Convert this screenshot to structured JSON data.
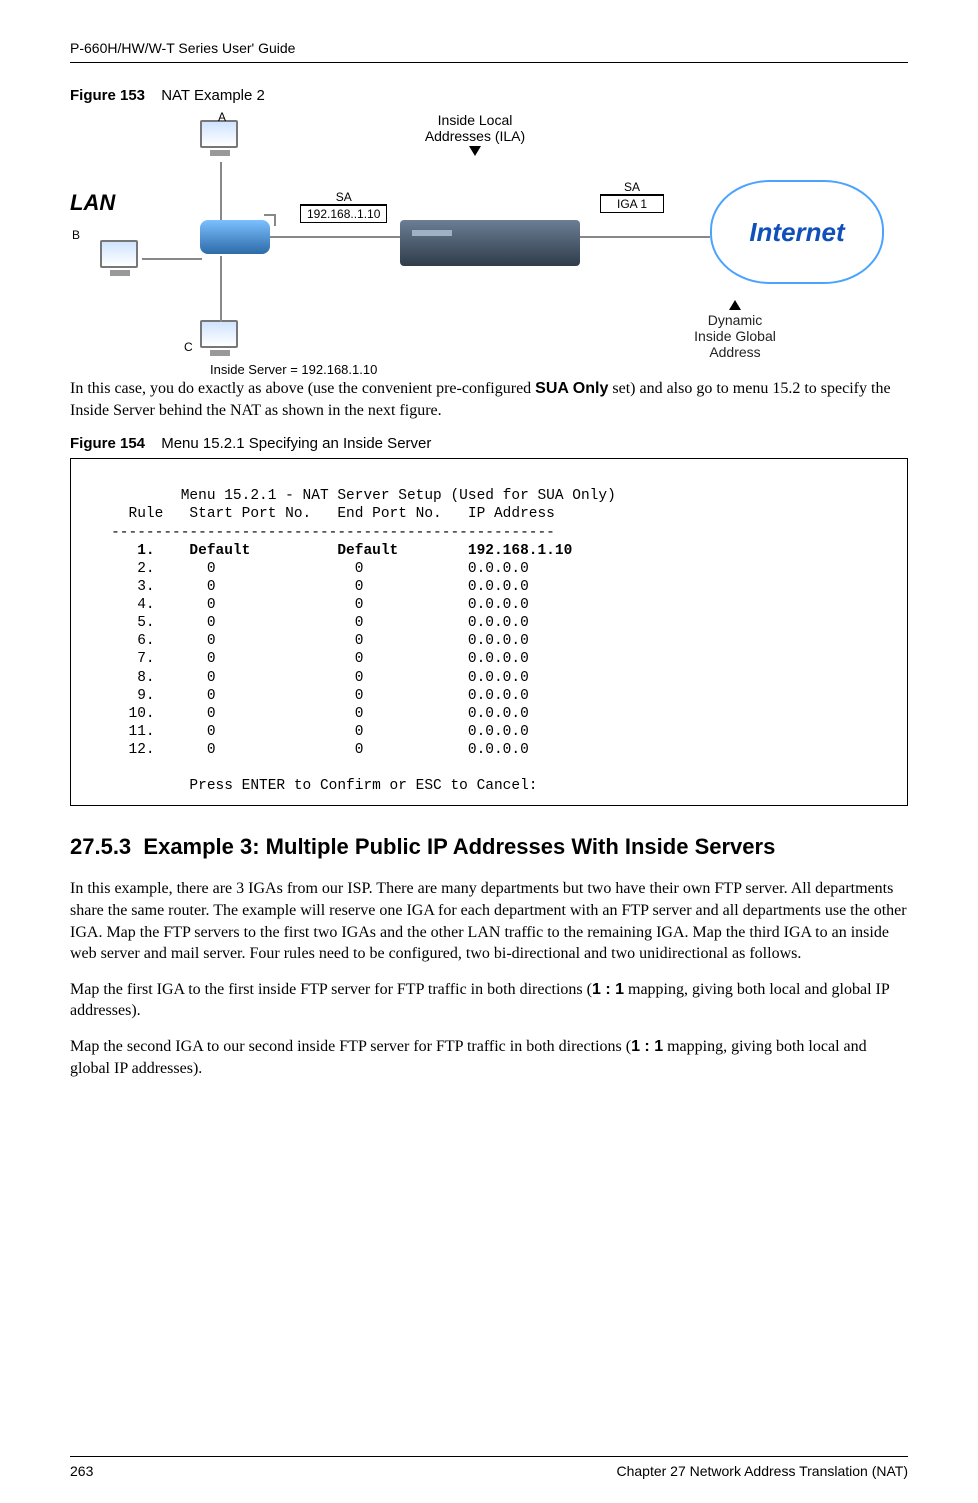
{
  "header": {
    "guide": "P-660H/HW/W-T Series User' Guide"
  },
  "fig153": {
    "label": "Figure 153",
    "title": "NAT Example 2"
  },
  "diagram": {
    "lan": "LAN",
    "A": "A",
    "B": "B",
    "C": "C",
    "sa1_t": "SA",
    "sa1_v": "192.168..1.10",
    "sa2_t": "SA",
    "sa2_v": "IGA 1",
    "ila": "Inside Local\nAddresses (ILA)",
    "internet": "Internet",
    "dig": "Dynamic\nInside Global\nAddress",
    "server": "Inside Server = 192.168.1.10"
  },
  "para1_a": "In this case, you do exactly as above (use the convenient pre-configured ",
  "para1_b": "SUA Only",
  "para1_c": " set) and also go to menu 15.2 to specify the Inside Server behind the NAT as shown in the next figure.",
  "fig154": {
    "label": "Figure 154",
    "title": "Menu 15.2.1 Specifying an Inside Server"
  },
  "menu": {
    "title": "           Menu 15.2.1 - NAT Server Setup (Used for SUA Only)",
    "header": "     Rule   Start Port No.   End Port No.   IP Address",
    "divider": "   ---------------------------------------------------",
    "rows": [
      "      1.    Default          Default        192.168.1.10",
      "      2.      0                0            0.0.0.0",
      "      3.      0                0            0.0.0.0",
      "      4.      0                0            0.0.0.0",
      "      5.      0                0            0.0.0.0",
      "      6.      0                0            0.0.0.0",
      "      7.      0                0            0.0.0.0",
      "      8.      0                0            0.0.0.0",
      "      9.      0                0            0.0.0.0",
      "     10.      0                0            0.0.0.0",
      "     11.      0                0            0.0.0.0",
      "     12.      0                0            0.0.0.0"
    ],
    "footer": "            Press ENTER to Confirm or ESC to Cancel:"
  },
  "section": {
    "num": "27.5.3",
    "title": "Example 3: Multiple Public IP Addresses With Inside Servers"
  },
  "para2": "In this example, there are 3 IGAs from our ISP. There are many departments but two have their own FTP server. All departments share the same router. The example will reserve one IGA for each department with an FTP server and all departments use the other IGA. Map the FTP servers to the first two IGAs and the other LAN traffic to the remaining IGA. Map the third IGA to an inside web server and mail server. Four rules need to be configured, two bi-directional and two unidirectional as follows.",
  "para3_a": "Map the first IGA to the first inside FTP server for FTP traffic in both directions (",
  "para3_b": "1 : 1",
  "para3_c": " mapping, giving both local and global IP addresses).",
  "para4_a": "Map the second IGA to our second inside FTP server for FTP traffic in both directions (",
  "para4_b": "1 : 1",
  "para4_c": " mapping, giving both local and global IP addresses).",
  "footer": {
    "page": "263",
    "chapter": "Chapter 27 Network Address Translation (NAT)"
  }
}
